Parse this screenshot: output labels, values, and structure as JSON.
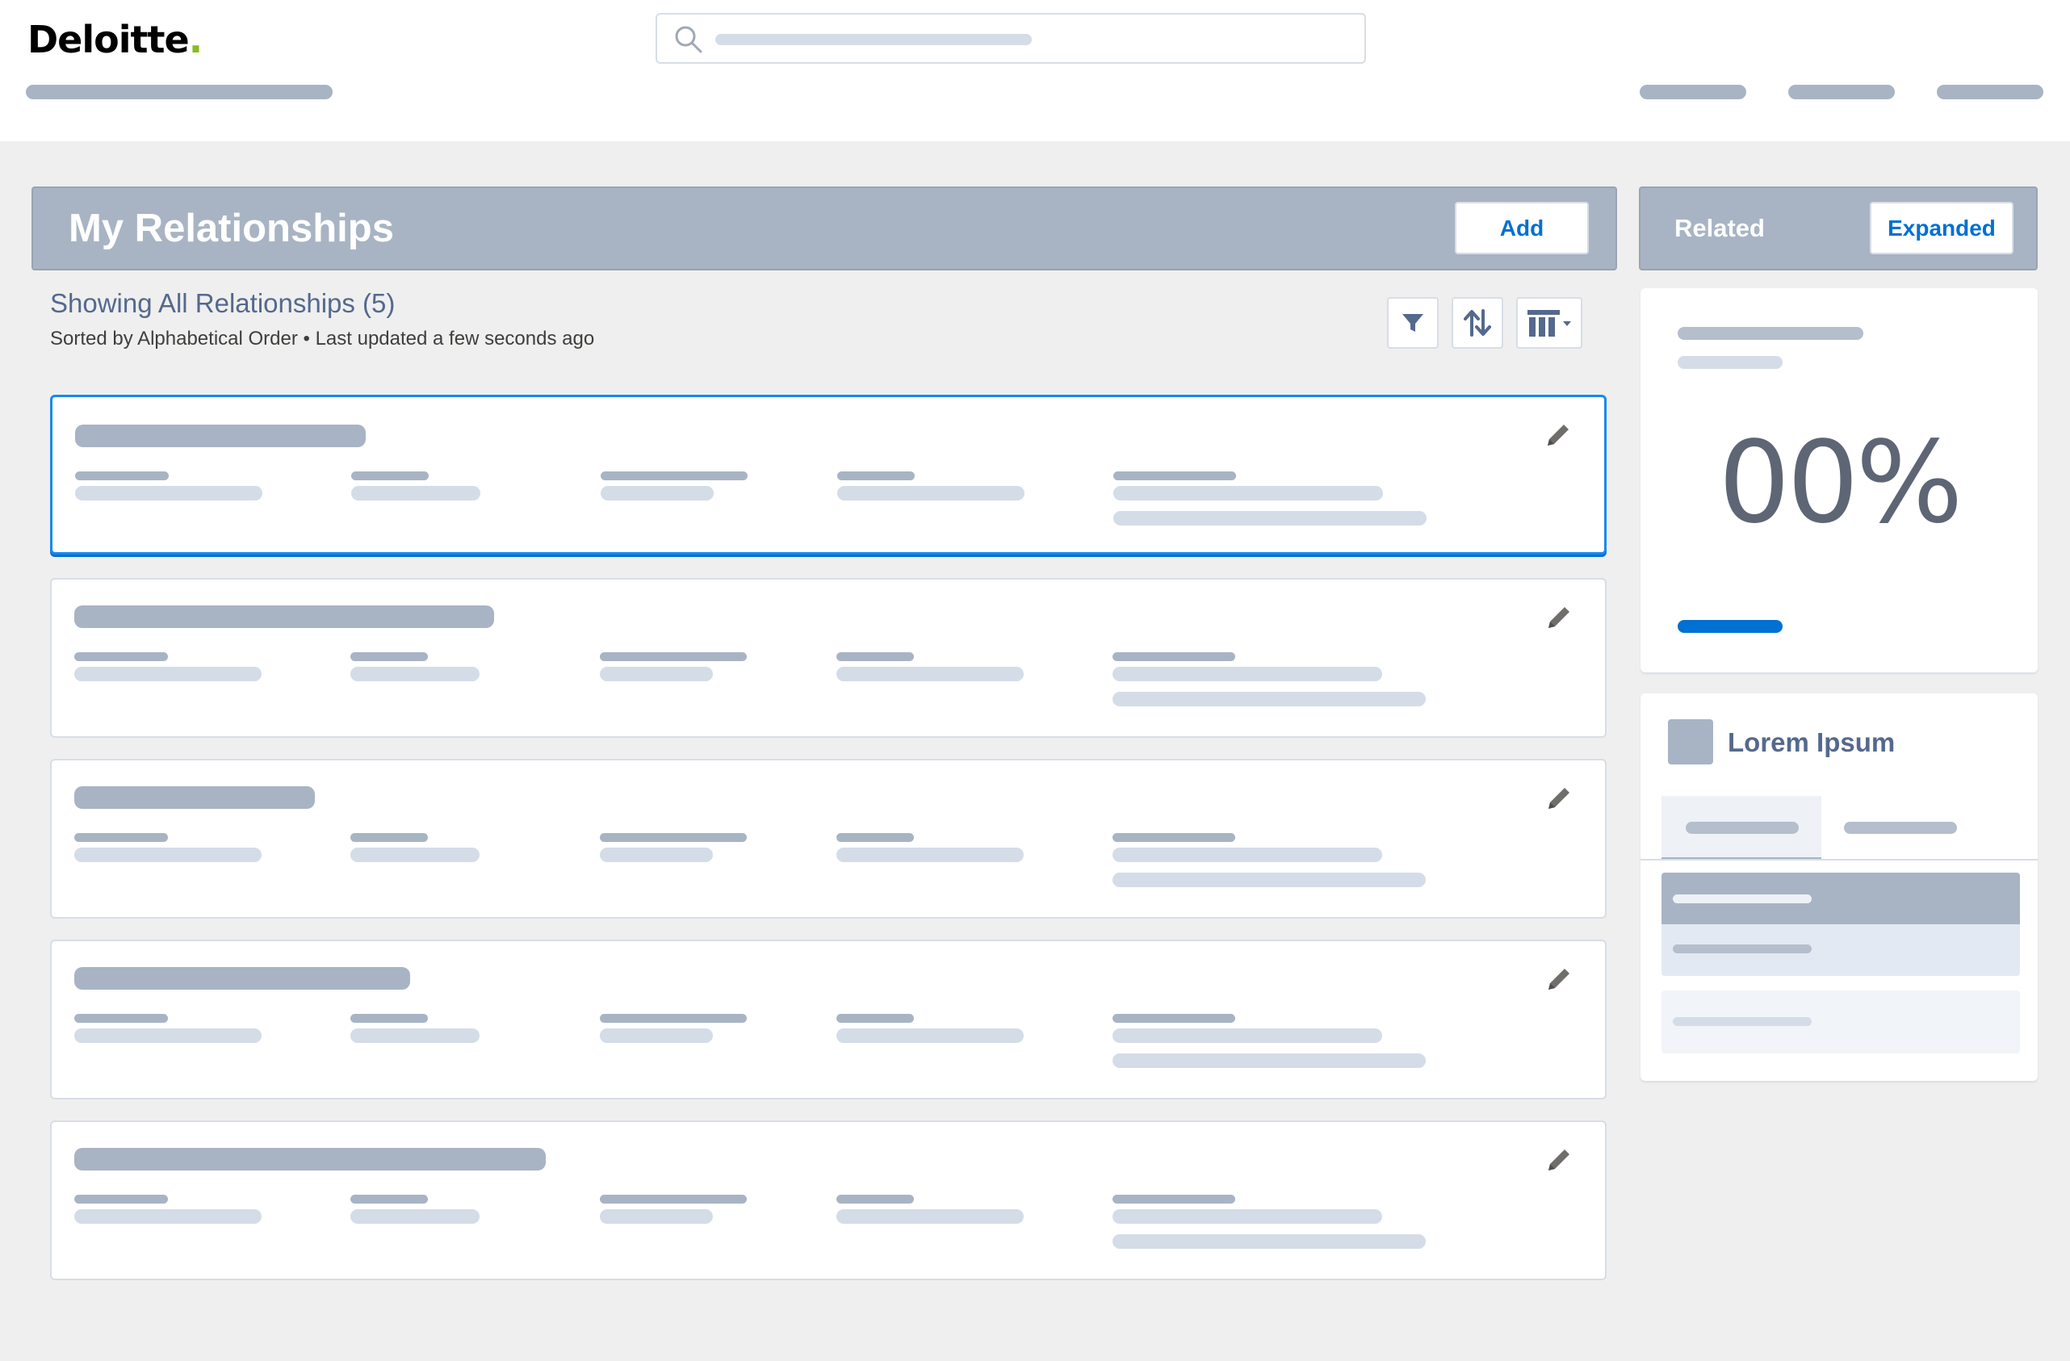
{
  "header": {
    "logo_text": "Deloitte",
    "logo_dot": ".",
    "search_icon": "search-icon"
  },
  "main": {
    "title": "My Relationships",
    "add_label": "Add",
    "list_title": "Showing All Relationships (5)",
    "list_subtitle": "Sorted by Alphabetical Order • Last updated a few seconds ago",
    "tools": [
      "filter-icon",
      "sort-icon",
      "columns-icon"
    ],
    "cards": [
      {
        "selected": true,
        "edit_icon": "pencil-icon"
      },
      {
        "selected": false,
        "edit_icon": "pencil-icon"
      },
      {
        "selected": false,
        "edit_icon": "pencil-icon"
      },
      {
        "selected": false,
        "edit_icon": "pencil-icon"
      },
      {
        "selected": false,
        "edit_icon": "pencil-icon"
      }
    ]
  },
  "related": {
    "title": "Related",
    "expanded_label": "Expanded",
    "stat_value": "00%",
    "lorem_title": "Lorem Ipsum"
  },
  "colors": {
    "accent": "#0070d2",
    "header_panel": "#a8b4c4",
    "skeleton_dark": "#a8b4c4",
    "skeleton_light": "#d4dce7",
    "brand_green": "#86bc25"
  }
}
